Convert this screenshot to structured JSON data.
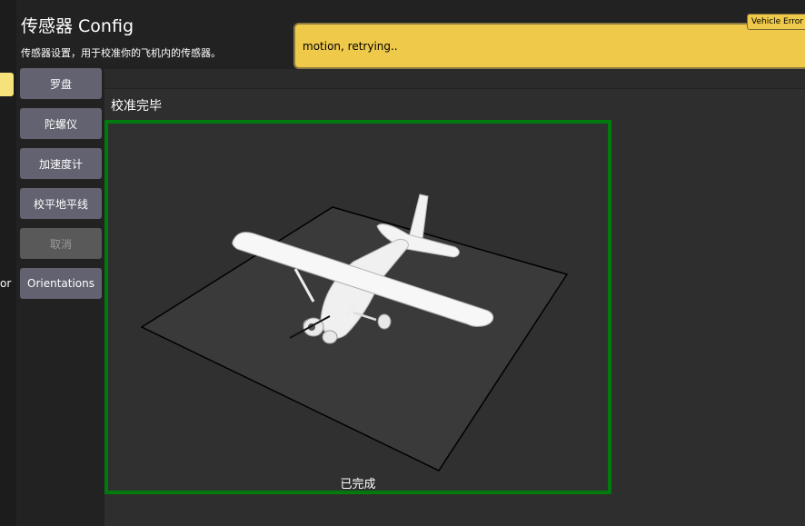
{
  "header": {
    "title": "传感器 Config",
    "description": "传感器设置，用于校准你的飞机内的传感器。"
  },
  "left_panel": {
    "clipped_text": "or"
  },
  "buttons": [
    {
      "label": "罗盘",
      "enabled": true
    },
    {
      "label": "陀螺仪",
      "enabled": true
    },
    {
      "label": "加速度计",
      "enabled": true
    },
    {
      "label": "校平地平线",
      "enabled": true
    },
    {
      "label": "取消",
      "enabled": false
    },
    {
      "label": "Orientations",
      "enabled": true
    }
  ],
  "calibration": {
    "status_title": "校准完毕",
    "done_label": "已完成"
  },
  "error": {
    "tag": "Vehicle Error",
    "message": "motion, retrying.."
  },
  "colors": {
    "status_border": "#007a0d",
    "error_banner": "#efc94a",
    "button": "#626270"
  }
}
